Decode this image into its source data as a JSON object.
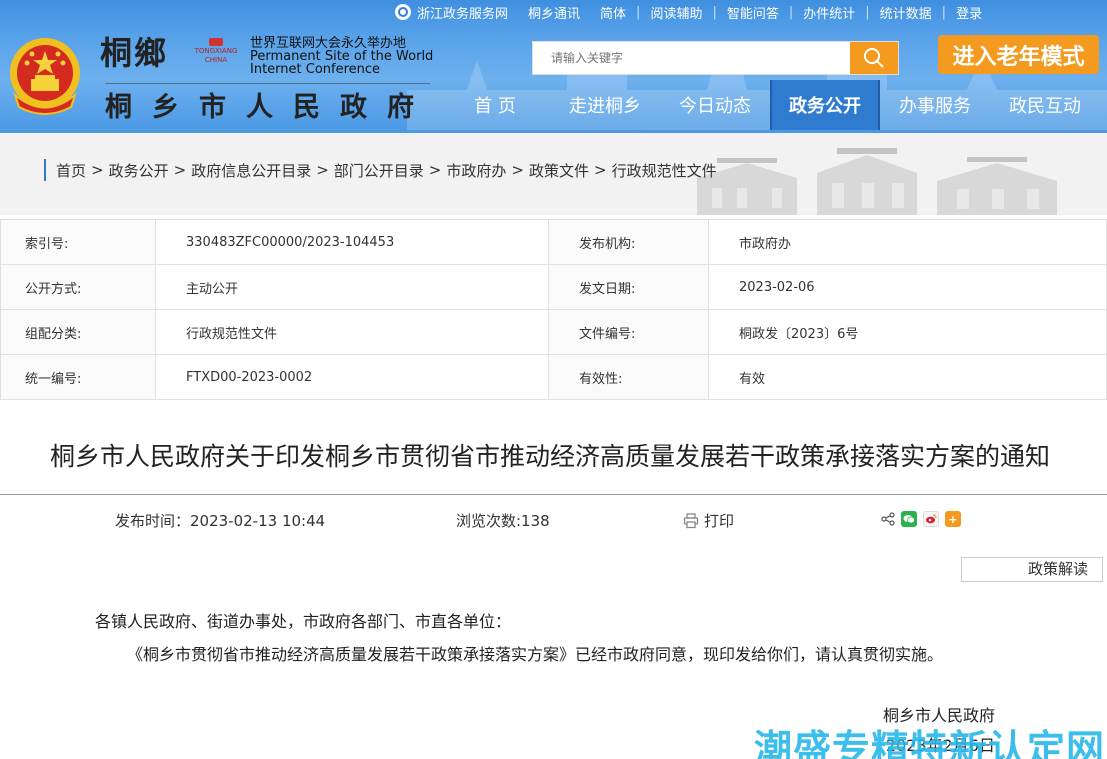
{
  "topbar": {
    "links": [
      "浙江政务服务网",
      "桐乡通讯",
      "简体",
      "阅读辅助",
      "智能问答",
      "办件统计",
      "统计数据",
      "登录"
    ]
  },
  "logo": {
    "city_calligraphy": "桐鄉",
    "tongxiang_en": "TONGXIANG CHINA",
    "wic_cn": "世界互联网大会永久举办地",
    "wic_en_1": "Permanent Site of the World",
    "wic_en_2": "Internet Conference",
    "site_name": "桐乡市人民政府"
  },
  "search": {
    "placeholder": "请输入关键字"
  },
  "elder_mode_label": "进入老年模式",
  "nav": {
    "items": [
      "首 页",
      "走进桐乡",
      "今日动态",
      "政务公开",
      "办事服务",
      "政民互动"
    ],
    "active": "政务公开"
  },
  "breadcrumb": [
    "首页",
    "政务公开",
    "政府信息公开目录",
    "部门公开目录",
    "市政府办",
    "政策文件",
    "行政规范性文件"
  ],
  "meta": {
    "rows": [
      {
        "k1": "索引号:",
        "v1": "330483ZFC00000/2023-104453",
        "k2": "发布机构:",
        "v2": "市政府办"
      },
      {
        "k1": "公开方式:",
        "v1": "主动公开",
        "k2": "发文日期:",
        "v2": "2023-02-06"
      },
      {
        "k1": "组配分类:",
        "v1": "行政规范性文件",
        "k2": "文件编号:",
        "v2": "桐政发〔2023〕6号"
      },
      {
        "k1": "统一编号:",
        "v1": "FTXD00-2023-0002",
        "k2": "有效性:",
        "v2": "有效"
      }
    ]
  },
  "article": {
    "title": "桐乡市人民政府关于印发桐乡市贯彻省市推动经济高质量发展若干政策承接落实方案的通知",
    "publish_time": "发布时间：2023-02-13  10:44",
    "views": "浏览次数:138",
    "print_label": "打印",
    "policy_interpret_label": "政策解读",
    "salutation": "各镇人民政府、街道办事处，市政府各部门、市直各单位：",
    "body": "《桐乡市贯彻省市推动经济高质量发展若干政策承接落实方案》已经市政府同意，现印发给你们，请认真贯彻实施。",
    "signer": "桐乡市人民政府",
    "sign_date": "2023年2月6日"
  },
  "watermark": "潮盛专精特新认定网",
  "colors": {
    "header_blue": "#4a98e4",
    "nav_active": "#2e7bd0",
    "accent_orange": "#f39a1f",
    "watermark_cyan": "#27b7ea"
  }
}
